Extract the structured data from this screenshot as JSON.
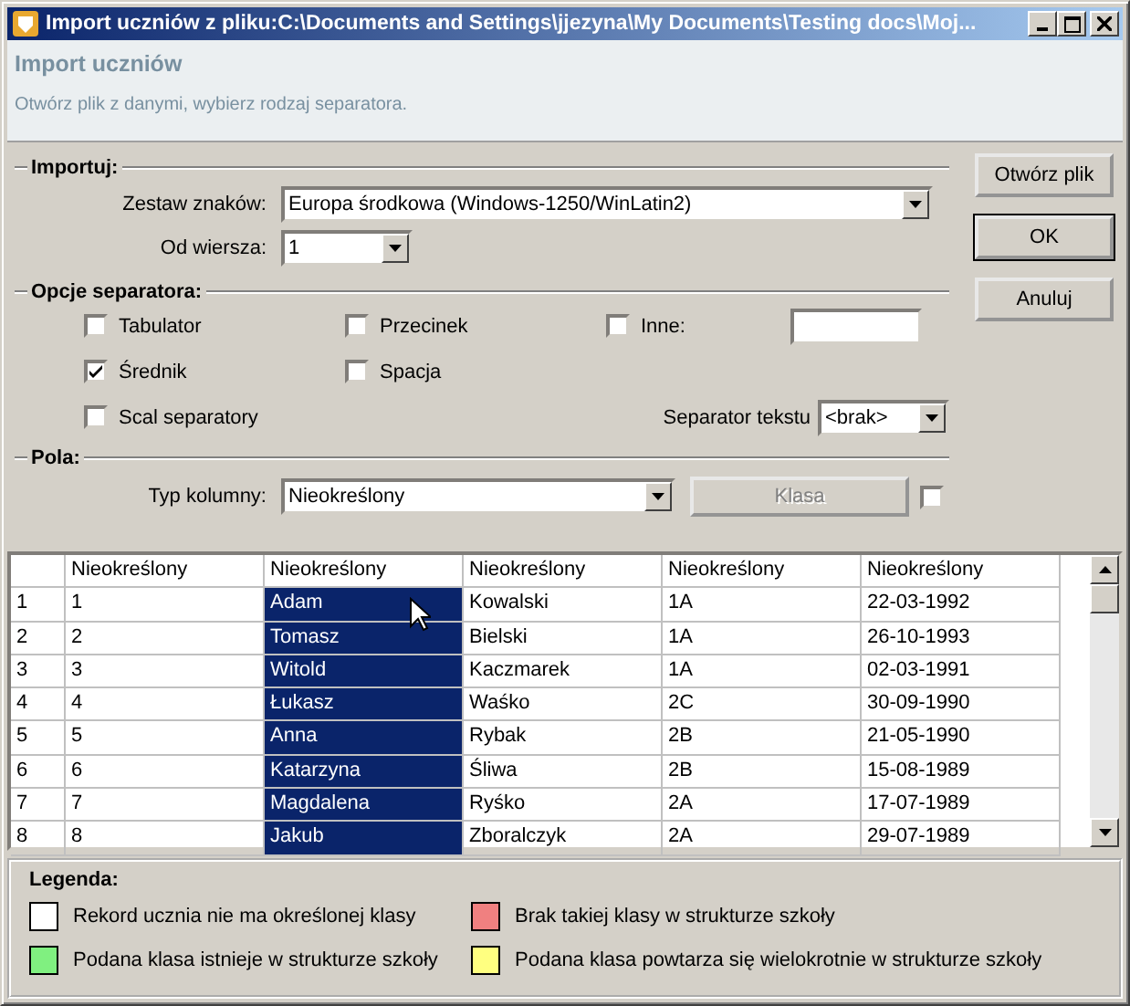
{
  "window": {
    "title": "Import uczniów z pliku:C:\\Documents and Settings\\jjezyna\\My Documents\\Testing docs\\Moj..."
  },
  "header": {
    "title": "Import uczniów",
    "subtitle": "Otwórz plik z danymi, wybierz rodzaj separatora."
  },
  "import_group": {
    "title": "Importuj:",
    "charset": {
      "label": "Zestaw znaków:",
      "value": "Europa środkowa (Windows-1250/WinLatin2)"
    },
    "from_row": {
      "label": "Od wiersza:",
      "value": "1"
    }
  },
  "separator_options": {
    "title": "Opcje separatora:",
    "rows": [
      [
        {
          "label": "Tabulator",
          "checked": false,
          "kind": "plain"
        },
        {
          "label": "Przecinek",
          "checked": false,
          "kind": "plain"
        },
        {
          "label": "Inne:",
          "checked": false,
          "kind": "with_field"
        }
      ],
      [
        {
          "label": "Średnik",
          "checked": true,
          "kind": "plain"
        },
        {
          "label": "Spacja",
          "checked": false,
          "kind": "plain"
        }
      ],
      [
        {
          "label": "Scal separatory",
          "checked": false,
          "kind": "plain"
        }
      ]
    ],
    "text_separator": {
      "label": "Separator tekstu",
      "value": "<brak>"
    }
  },
  "fields": {
    "title": "Pola:",
    "column_type": {
      "label": "Typ kolumny:",
      "value": "Nieokreślony"
    },
    "class_button": {
      "label": "Klasa",
      "disabled": true
    },
    "checkbox": {
      "checked": false
    }
  },
  "buttons": [
    {
      "label": "Otwórz plik",
      "default": false
    },
    {
      "label": "OK",
      "default": true
    },
    {
      "label": "Anuluj",
      "default": false
    }
  ],
  "table": {
    "columns": [
      {
        "label": "Nieokreślony",
        "selected": false
      },
      {
        "label": "Nieokreślony",
        "selected": true
      },
      {
        "label": "Nieokreślony",
        "selected": false
      },
      {
        "label": "Nieokreślony",
        "selected": false
      },
      {
        "label": "Nieokreślony",
        "selected": false
      }
    ],
    "rows": [
      {
        "number": "1",
        "cells": [
          "1",
          "Adam",
          "Kowalski",
          "1A",
          "22-03-1992"
        ]
      },
      {
        "number": "2",
        "cells": [
          "2",
          "Tomasz",
          "Bielski",
          "1A",
          "26-10-1993"
        ]
      },
      {
        "number": "3",
        "cells": [
          "3",
          "Witold",
          "Kaczmarek",
          "1A",
          "02-03-1991"
        ]
      },
      {
        "number": "4",
        "cells": [
          "4",
          "Łukasz",
          "Waśko",
          "2C",
          "30-09-1990"
        ]
      },
      {
        "number": "5",
        "cells": [
          "5",
          "Anna",
          "Rybak",
          "2B",
          "21-05-1990"
        ]
      },
      {
        "number": "6",
        "cells": [
          "6",
          "Katarzyna",
          "Śliwa",
          "2B",
          "15-08-1989"
        ]
      },
      {
        "number": "7",
        "cells": [
          "7",
          "Magdalena",
          "Ryśko",
          "2A",
          "17-07-1989"
        ]
      },
      {
        "number": "8",
        "cells": [
          "8",
          "Jakub",
          "Zboralczyk",
          "2A",
          "29-07-1989"
        ]
      }
    ]
  },
  "legend": {
    "title": "Legenda:",
    "items": [
      {
        "label": "Rekord ucznia nie ma określonej klasy",
        "color": "#ffffff"
      },
      {
        "label": "Brak takiej klasy w strukturze szkoły",
        "color": "#f08080"
      },
      {
        "label": "Podana klasa istnieje w strukturze szkoły",
        "color": "#80f080"
      },
      {
        "label": "Podana klasa powtarza się wielokrotnie w strukturze szkoły",
        "color": "#ffff80"
      }
    ]
  }
}
